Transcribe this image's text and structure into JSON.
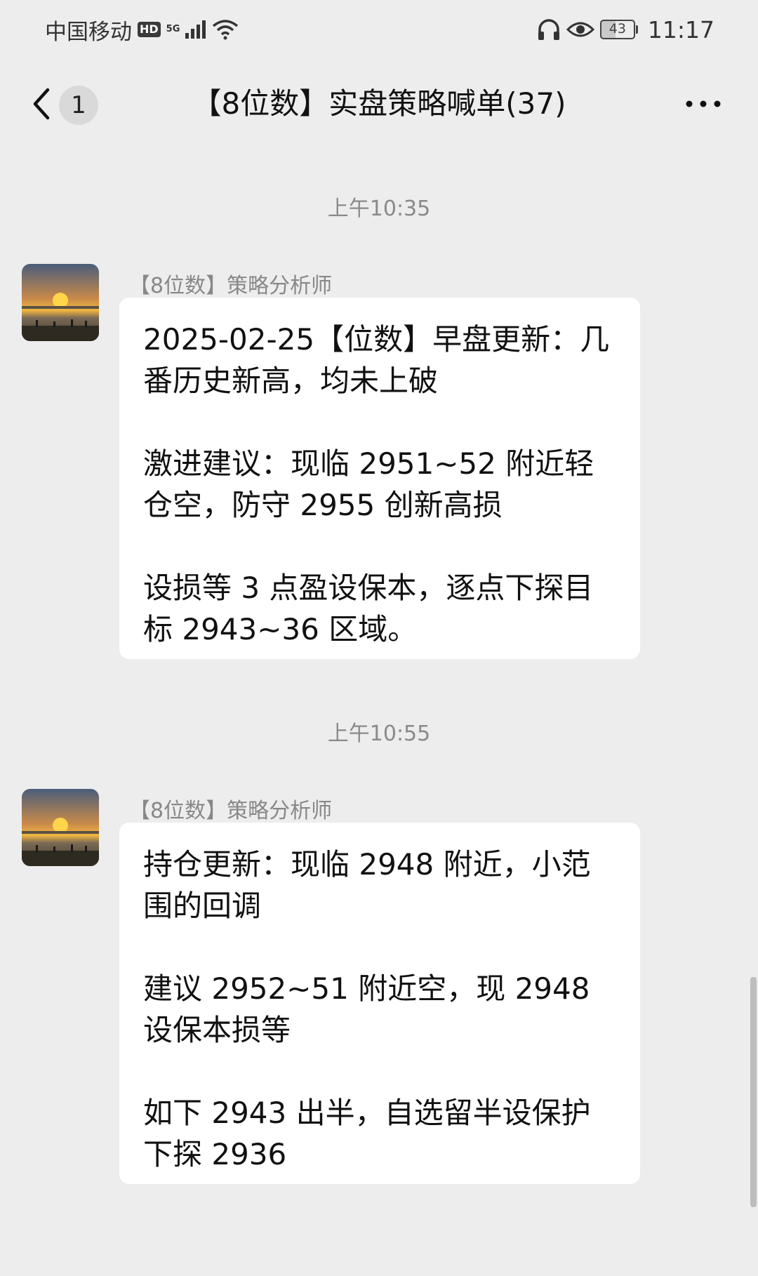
{
  "status_bar": {
    "carrier": "中国移动",
    "hd_badge": "HD",
    "network": "5G",
    "battery": "43",
    "time": "11:17"
  },
  "nav": {
    "unread_count": "1",
    "title": "【8位数】实盘策略喊单(37)"
  },
  "messages": [
    {
      "timestamp": "上午10:35",
      "sender": "【8位数】策略分析师",
      "paragraphs": [
        "2025-02-25【位数】早盘更新：几番历史新高，均未上破",
        "激进建议：现临 2951~52 附近轻仓空，防守 2955 创新高损",
        "设损等 3 点盈设保本，逐点下探目标 2943~36 区域。"
      ]
    },
    {
      "timestamp": "上午10:55",
      "sender": "【8位数】策略分析师",
      "paragraphs": [
        "持仓更新：现临 2948 附近，小范围的回调",
        "建议 2952~51 附近空，现 2948 设保本损等",
        "如下 2943 出半，自选留半设保护下探 2936"
      ]
    }
  ]
}
